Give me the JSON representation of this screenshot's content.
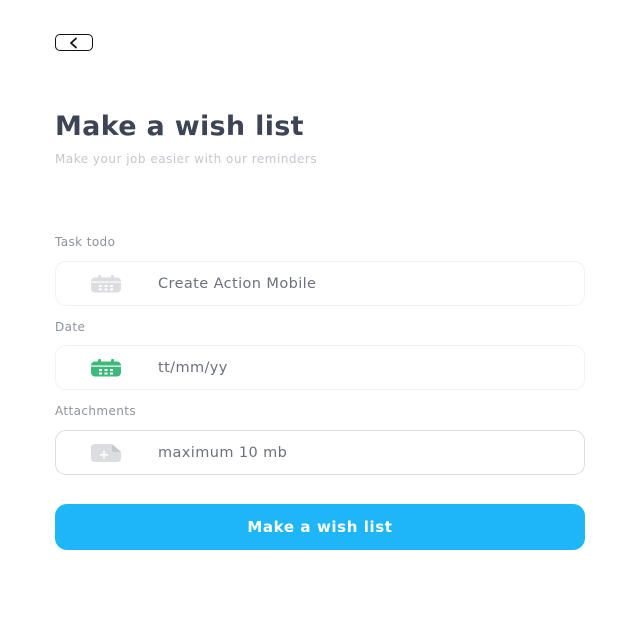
{
  "header": {
    "back_icon": "chevron-left-icon",
    "title": "Make a wish list",
    "subtitle": "Make your job easier with our reminders"
  },
  "form": {
    "task": {
      "label": "Task todo",
      "value": "Create Action Mobile",
      "icon": "calendar-icon",
      "icon_color": "#dcdde1"
    },
    "date": {
      "label": "Date",
      "placeholder": "tt/mm/yy",
      "icon": "calendar-icon",
      "icon_color": "#3dba7b"
    },
    "attachments": {
      "label": "Attachments",
      "placeholder": "maximum 10 mb",
      "icon": "add-file-icon",
      "icon_color": "#dcdde1"
    }
  },
  "submit": {
    "label": "Make a wish list",
    "color": "#1fb6f7"
  }
}
